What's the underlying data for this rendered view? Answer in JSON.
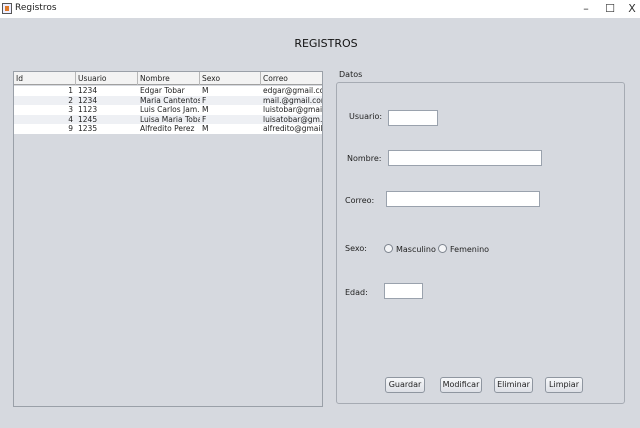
{
  "window": {
    "title": "Registros",
    "minimize": "–",
    "maximize": "☐",
    "close": "X"
  },
  "heading": "REGISTROS",
  "table": {
    "columns": [
      "Id",
      "Usuario",
      "Nombre",
      "Sexo",
      "Correo"
    ],
    "rows": [
      [
        "1",
        "1234",
        "Edgar Tobar",
        "M",
        "edgar@gmail.com"
      ],
      [
        "2",
        "1234",
        "Maria Cantentos",
        "F",
        "mail.@gmail.com"
      ],
      [
        "3",
        "1123",
        "Luis Carlos Jam...",
        "M",
        "luistobar@gmai..."
      ],
      [
        "4",
        "1245",
        "Luisa Maria Tobar",
        "F",
        "luisatobar@gm..."
      ],
      [
        "9",
        "1235",
        "Alfredito Perez",
        "M",
        "alfredito@gmail"
      ]
    ]
  },
  "form": {
    "legend": "Datos",
    "usuario_label": "Usuario:",
    "usuario_value": "",
    "nombre_label": "Nombre:",
    "nombre_value": "",
    "correo_label": "Correo:",
    "correo_value": "",
    "sexo_label": "Sexo:",
    "masculino_label": "Masculino",
    "femenino_label": "Femenino",
    "edad_label": "Edad:",
    "edad_value": ""
  },
  "buttons": {
    "guardar": "Guardar",
    "modificar": "Modificar",
    "eliminar": "Eliminar",
    "limpiar": "Limpiar"
  }
}
